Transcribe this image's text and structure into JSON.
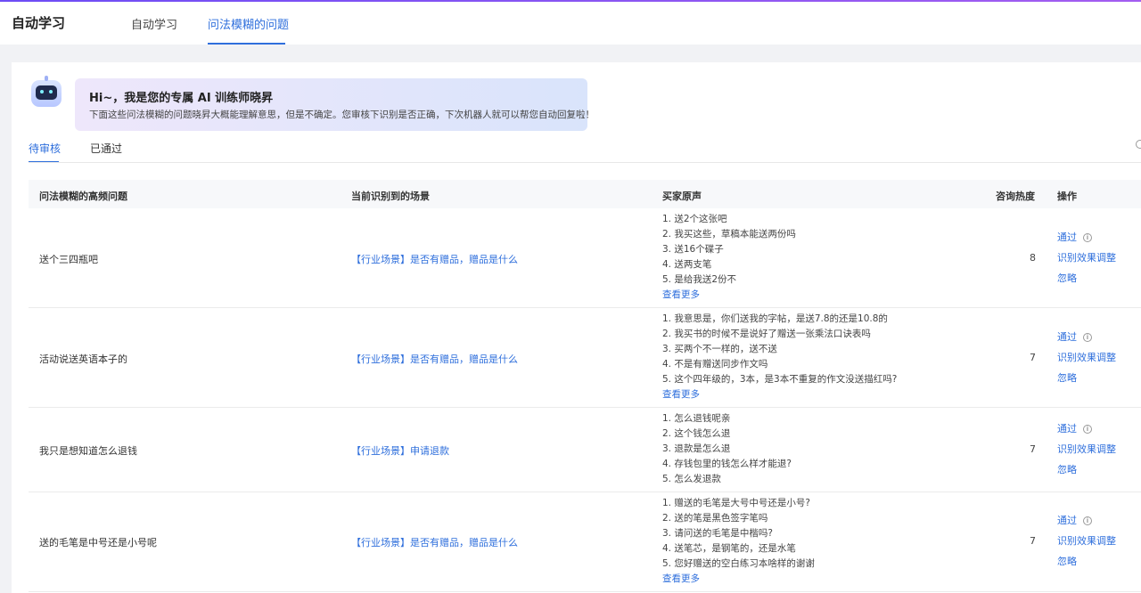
{
  "header": {
    "app_title": "自动学习",
    "tabs": [
      {
        "label": "自动学习",
        "active": false
      },
      {
        "label": "问法模糊的问题",
        "active": true
      }
    ]
  },
  "banner": {
    "title": "Hi~，我是您的专属 AI 训练师晓昇",
    "subtitle": "下面这些问法模糊的问题晓昇大概能理解意思，但是不确定。您审核下识别是否正确，下次机器人就可以帮您自动回复啦！",
    "avatar_icon": "robot-icon"
  },
  "status_tabs": [
    {
      "label": "待审核",
      "active": true
    },
    {
      "label": "已通过",
      "active": false
    }
  ],
  "table": {
    "columns": [
      "问法模糊的高频问题",
      "当前识别到的场景",
      "买家原声",
      "咨询热度",
      "操作"
    ],
    "actions": {
      "approve": "通过",
      "adjust": "识别效果调整",
      "ignore": "忽略"
    },
    "rows": [
      {
        "question": "送个三四瓶吧",
        "scene": "【行业场景】是否有赠品，赠品是什么",
        "voices": [
          "1. 送2个这张吧",
          "2. 我买这些，草稿本能送两份吗",
          "3. 送16个碟子",
          "4. 送两支笔",
          "5. 是给我送2份不"
        ],
        "more": "查看更多",
        "heat": "8"
      },
      {
        "question": "活动说送英语本子的",
        "scene": "【行业场景】是否有赠品，赠品是什么",
        "voices": [
          "1. 我意思是，你们送我的字帖，是送7.8的还是10.8的",
          "2. 我买书的时候不是说好了赠送一张乘法口诀表吗",
          "3. 买两个不一样的，送不送",
          "4. 不是有赠送同步作文吗",
          "5. 这个四年级的，3本，是3本不重复的作文没送描红吗?"
        ],
        "more": "查看更多",
        "heat": "7"
      },
      {
        "question": "我只是想知道怎么退钱",
        "scene": "【行业场景】申请退款",
        "voices": [
          "1. 怎么退钱呢亲",
          "2. 这个钱怎么退",
          "3. 退款是怎么退",
          "4. 存钱包里的钱怎么样才能退?",
          "5. 怎么发退款"
        ],
        "more": "",
        "heat": "7"
      },
      {
        "question": "送的毛笔是中号还是小号呢",
        "scene": "【行业场景】是否有赠品，赠品是什么",
        "voices": [
          "1. 赠送的毛笔是大号中号还是小号?",
          "2. 送的笔是黑色签字笔吗",
          "3. 请问送的毛笔是中楷吗?",
          "4. 送笔芯，是钢笔的，还是水笔",
          "5. 您好赠送的空白练习本啥样的谢谢"
        ],
        "more": "查看更多",
        "heat": "7"
      }
    ]
  }
}
